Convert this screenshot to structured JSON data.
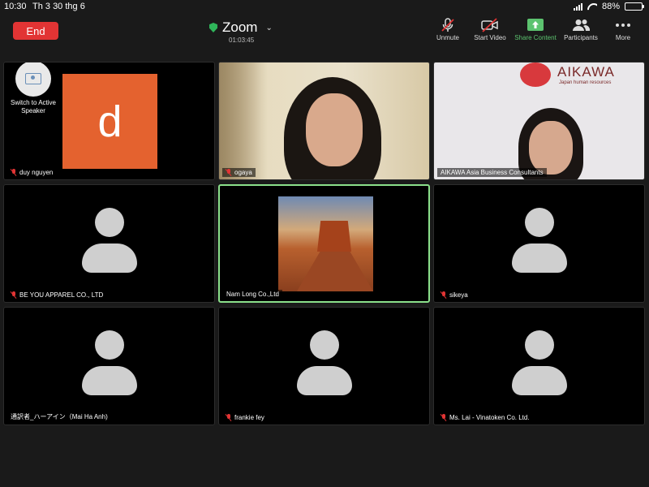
{
  "status_bar": {
    "time": "10:30",
    "date": "Th 3 30 thg 6",
    "battery": "88%",
    "battery_level": 0.88
  },
  "header": {
    "end_label": "End",
    "title": "Zoom",
    "timer": "01:03:45",
    "accent_end": "#e23434",
    "accent_share": "#5cc36f"
  },
  "toolbar": {
    "unmute": "Unmute",
    "start_video": "Start Video",
    "share_content": "Share Content",
    "participants": "Participants",
    "more": "More"
  },
  "switch_speaker": "Switch to Active Speaker",
  "participants": [
    {
      "name": "duy nguyen",
      "muted": true,
      "avatar_letter": "d",
      "avatar_color": "#e4622f"
    },
    {
      "name": "ogaya",
      "muted": true
    },
    {
      "name": "AIKAWA Asia Business Consultants",
      "muted": false,
      "logo_text": "AIKAWA",
      "logo_sub": "Japan human resources"
    },
    {
      "name": "BE YOU APPAREL CO., LTD",
      "muted": true
    },
    {
      "name": "Nam Long Co.,Ltd",
      "muted": false,
      "active": true
    },
    {
      "name": "sikeya",
      "muted": true
    },
    {
      "name": "通訳者_ハーアイン（Mai Ha Anh)",
      "muted": false
    },
    {
      "name": "frankie fey",
      "muted": true
    },
    {
      "name": "Ms. Lai - Vinatoken Co. Ltd.",
      "muted": true
    }
  ]
}
